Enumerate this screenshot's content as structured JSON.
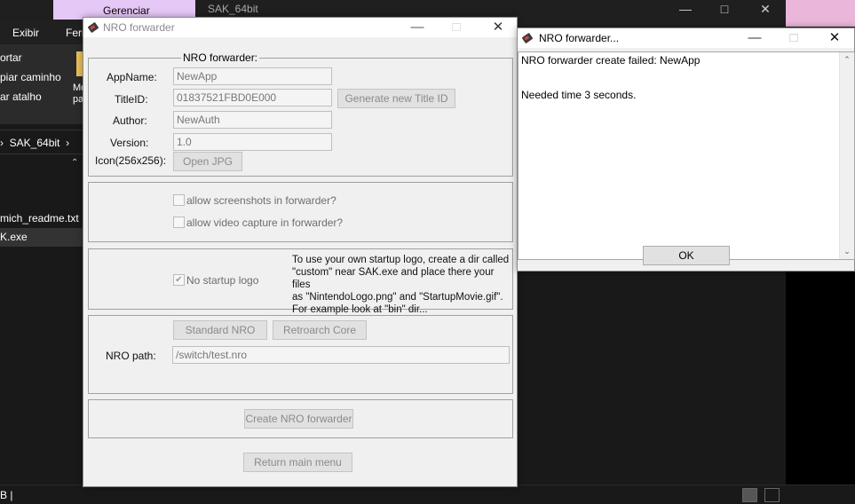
{
  "explorer": {
    "context_tab": "Gerenciar",
    "title": "SAK_64bit",
    "ribbon_tabs": [
      "Exibir",
      "Ferr"
    ],
    "ribbon_items": [
      "ortar",
      "piar caminho",
      "ar atalho"
    ],
    "ribbon_side": [
      "Mo",
      "pa"
    ],
    "breadcrumb": "SAK_64bit",
    "files": [
      "mich_readme.txt",
      "K.exe"
    ],
    "status_text": "B  |"
  },
  "main_dialog": {
    "title": "NRO forwarder",
    "group_title": "NRO forwarder:",
    "app_name_label": "AppName:",
    "app_name_value": "NewApp",
    "title_id_label": "TitleID:",
    "title_id_value": "01837521FBD0E000",
    "generate_button": "Generate new Title ID",
    "author_label": "Author:",
    "author_value": "NewAuth",
    "version_label": "Version:",
    "version_value": "1.0",
    "icon_label": "Icon(256x256):",
    "open_jpg_button": "Open JPG",
    "allow_screenshots": "allow screenshots in forwarder?",
    "allow_video": "allow video capture in forwarder?",
    "no_startup_logo": "No startup logo",
    "no_startup_logo_checked": true,
    "logo_info": [
      "To use your own startup logo, create a dir called",
      "\"custom\" near SAK.exe and place there your files",
      "as \"NintendoLogo.png\" and \"StartupMovie.gif\".",
      "For example look at \"bin\" dir..."
    ],
    "standard_nro_button": "Standard NRO",
    "retroarch_button": "Retroarch Core",
    "nro_path_label": "NRO path:",
    "nro_path_value": "/switch/test.nro",
    "create_button": "Create NRO forwarder",
    "return_button": "Return main menu"
  },
  "result_dialog": {
    "title": "NRO forwarder...",
    "message_line1": "NRO forwarder create failed: NewApp",
    "message_line2": "Needed time 3 seconds.",
    "ok_button": "OK"
  },
  "icons": {
    "minimize": "minimize-icon",
    "maximize": "maximize-icon",
    "close": "close-icon",
    "app": "cartridge-icon"
  }
}
